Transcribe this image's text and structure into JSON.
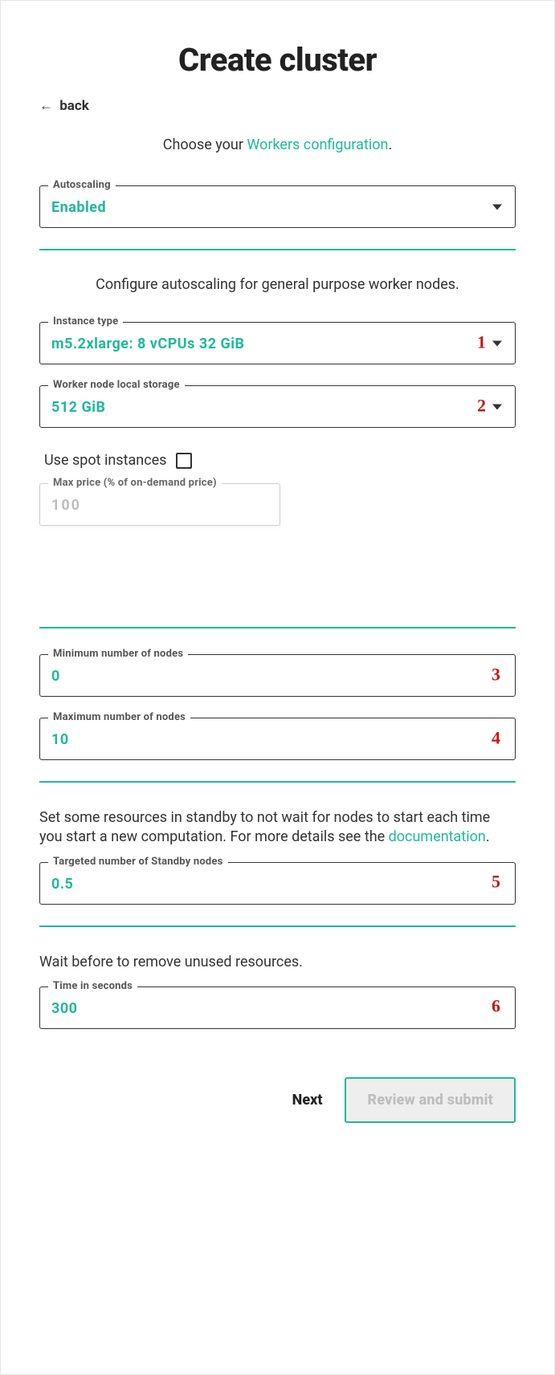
{
  "header": {
    "title": "Create cluster",
    "back_label": "back",
    "subtitle_prefix": "Choose your ",
    "subtitle_link": "Workers configuration",
    "subtitle_suffix": "."
  },
  "autoscaling": {
    "legend": "Autoscaling",
    "value": "Enabled"
  },
  "section1_desc": "Configure autoscaling for general purpose worker nodes.",
  "instance_type": {
    "legend": "Instance type",
    "value": "m5.2xlarge: 8 vCPUs 32 GiB",
    "annot": "1"
  },
  "storage": {
    "legend": "Worker node local storage",
    "value": "512 GiB",
    "annot": "2"
  },
  "spot": {
    "label": "Use spot instances",
    "checked": false,
    "max_price_legend": "Max price (% of on-demand price)",
    "max_price_value": "100"
  },
  "min_nodes": {
    "legend": "Minimum number of nodes",
    "value": "0",
    "annot": "3"
  },
  "max_nodes": {
    "legend": "Maximum number of nodes",
    "value": "10",
    "annot": "4"
  },
  "standby": {
    "desc_prefix": "Set some resources in standby to not wait for nodes to start each time you start a new computation. For more details see the ",
    "desc_link": "documentation",
    "desc_suffix": ".",
    "legend": "Targeted number of Standby nodes",
    "value": "0.5",
    "annot": "5"
  },
  "wait": {
    "desc": "Wait before to remove unused resources.",
    "legend": "Time in seconds",
    "value": "300",
    "annot": "6"
  },
  "footer": {
    "next_label": "Next",
    "review_label": "Review and submit"
  }
}
